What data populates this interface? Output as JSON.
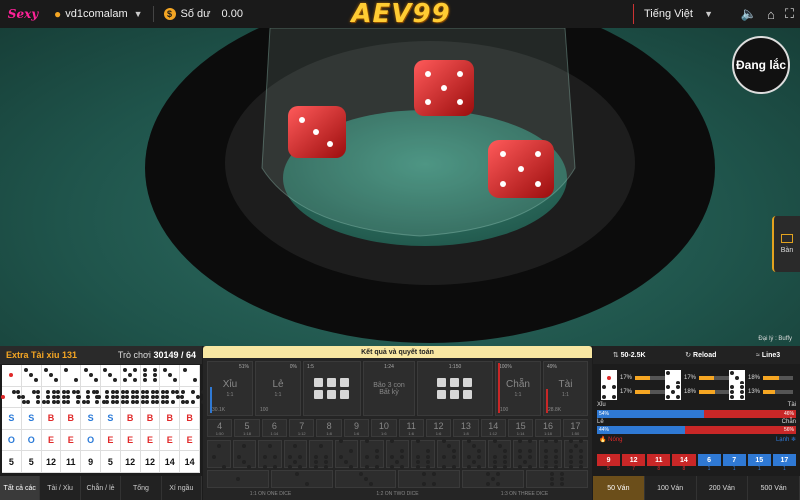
{
  "topbar": {
    "brand": "Sexy",
    "username": "vd1comalam",
    "balance_label": "Số dư",
    "balance_value": "0.00",
    "logo": "AEV99",
    "language": "Tiếng Việt"
  },
  "stage": {
    "shaking_label": "Đang lắc",
    "side_tab_label": "Bàn",
    "dealer_label": "Đại lý : Buffy"
  },
  "roadmap": {
    "game_name": "Extra Tài xỉu 131",
    "round_label": "Trò chơi",
    "round_value": "30149 / 64",
    "dice_rows": [
      [
        1,
        3,
        3,
        2,
        3,
        3,
        5,
        6,
        3,
        2
      ],
      [
        1,
        3,
        6,
        6,
        6,
        6,
        6,
        6,
        6,
        3
      ],
      [
        3,
        2,
        6,
        3,
        3,
        6,
        6,
        6,
        5,
        5
      ]
    ],
    "size_row": [
      "S",
      "S",
      "B",
      "B",
      "S",
      "S",
      "B",
      "B",
      "B",
      "B"
    ],
    "oddeven_row": [
      "O",
      "O",
      "E",
      "E",
      "O",
      "E",
      "E",
      "E",
      "E",
      "E"
    ],
    "sum_row": [
      "5",
      "5",
      "12",
      "11",
      "9",
      "5",
      "12",
      "12",
      "14",
      "14"
    ],
    "tabs": [
      "Tất cả các",
      "Tài / Xỉu",
      "Chẵn / lẻ",
      "Tổng",
      "Xí ngầu"
    ]
  },
  "board": {
    "title": "Kết quả và quyết toán",
    "xiu": {
      "label": "Xỉu",
      "ratio": "1:1",
      "pct": "51%",
      "foot": "30.1K"
    },
    "le": {
      "label": "Lẻ",
      "ratio": "1:1",
      "pct": "0%",
      "foot": "100"
    },
    "chan": {
      "label": "Chẵn",
      "ratio": "1:1",
      "pct": "100%",
      "foot": "100"
    },
    "tai": {
      "label": "Tài",
      "ratio": "1:1",
      "pct": "49%",
      "foot": "28.8K"
    },
    "triple_label": "Bão 3 con Bất kỳ",
    "triple_ratio": "1:24",
    "ratio_left": "1:5",
    "ratio_right": "1:150",
    "sums": [
      "4",
      "5",
      "6",
      "7",
      "8",
      "9",
      "10",
      "11",
      "12",
      "13",
      "14",
      "15",
      "16",
      "17"
    ],
    "sum_ratios": [
      "1:50",
      "1:18",
      "1:14",
      "1:12",
      "1:8",
      "1:6",
      "1:6",
      "1:6",
      "1:6",
      "1:8",
      "1:12",
      "1:14",
      "1:18",
      "1:50"
    ],
    "one_on": [
      "1:1 ON ONE DICE",
      "1:2 ON TWO DICE",
      "1:3 ON THREE DICE"
    ]
  },
  "stats": {
    "limit": "50-2.5K",
    "reload": "Reload",
    "line": "Line3",
    "faces": [
      {
        "face": 1,
        "pct": "17%"
      },
      {
        "face": 2,
        "pct": "17%"
      },
      {
        "face": 3,
        "pct": "18%"
      },
      {
        "face": 4,
        "pct": "17%"
      },
      {
        "face": 5,
        "pct": "18%"
      },
      {
        "face": 6,
        "pct": "13%"
      }
    ],
    "xiu_label": "Xỉu",
    "tai_label": "Tài",
    "xiu_pct": "54%",
    "tai_pct": "46%",
    "le_label": "Lẻ",
    "chan_label": "Chẵn",
    "le_pct": "44%",
    "chan_pct": "56%",
    "hot_label": "Nóng",
    "cold_label": "Lạnh",
    "history": [
      {
        "v": "9",
        "c": "5",
        "t": "red"
      },
      {
        "v": "12",
        "c": "7",
        "t": "red"
      },
      {
        "v": "11",
        "c": "8",
        "t": "red"
      },
      {
        "v": "14",
        "c": "8",
        "t": "red"
      },
      {
        "v": "6",
        "c": "1",
        "t": "blue"
      },
      {
        "v": "7",
        "c": "1",
        "t": "blue"
      },
      {
        "v": "15",
        "c": "1",
        "t": "blue"
      },
      {
        "v": "17",
        "c": "1",
        "t": "blue"
      }
    ],
    "tabs": [
      "50 Ván",
      "100 Ván",
      "200 Ván",
      "500 Ván"
    ]
  }
}
